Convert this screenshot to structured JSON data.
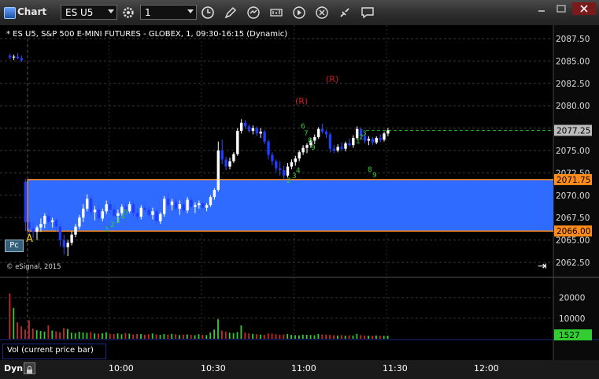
{
  "window": {
    "title": "Chart",
    "symbol": "ES U5",
    "interval": "1"
  },
  "chart": {
    "description": "* ES U5, S&P 500 E-MINI FUTURES - GLOBEX, 1, 09:30-16:15 (Dynamic)",
    "copyright": "© eSignal, 2015",
    "pc_button": "Pc",
    "goto_end_icon": "⇥",
    "price_ticks": [
      "2087.50",
      "2085.00",
      "2082.50",
      "2080.00",
      "2077.25",
      "2075.00",
      "2072.50",
      "2071.75",
      "2070.00",
      "2067.50",
      "2066.00",
      "2065.00",
      "2062.50"
    ],
    "last_price": "2077.25",
    "upper_level": "2071.75",
    "lower_level": "2066.00",
    "annotations": {
      "r1": "(R)",
      "r2": "(R)",
      "a": "A"
    },
    "volume_ticks": [
      "20000",
      "10000"
    ],
    "last_volume": "1527",
    "volume_label": "Vol (current price bar)",
    "time_ticks": [
      "10:00",
      "10:30",
      "11:00",
      "11:30",
      "12:00"
    ],
    "bottom_label": "Dyn",
    "colors": {
      "band": "#2f6bff",
      "level_line": "#ff8c1a",
      "price_box": "#ff8c1a",
      "last_box": "#bcbcbc",
      "vol_up": "#33cc33",
      "vol_down": "#cc2a2a",
      "vol_last_box": "#33cc33"
    }
  },
  "chart_data": {
    "type": "candlestick",
    "bars": [
      [
        2085.6,
        2085.8,
        2085.2,
        2085.4
      ],
      [
        2085.4,
        2085.7,
        2085.1,
        2085.5
      ],
      [
        2085.5,
        2085.9,
        2085.2,
        2085.3
      ],
      [
        2085.3,
        2085.6,
        2084.9,
        2085.1
      ],
      [
        2071.5,
        2071.8,
        2066.0,
        2067.0
      ],
      [
        2067.0,
        2067.5,
        2065.6,
        2066.3
      ],
      [
        2066.3,
        2067.0,
        2065.2,
        2065.9
      ],
      [
        2065.9,
        2066.6,
        2065.0,
        2066.4
      ],
      [
        2066.4,
        2067.4,
        2065.9,
        2066.8
      ],
      [
        2066.8,
        2068.0,
        2066.3,
        2067.7
      ],
      [
        2067.7,
        2068.2,
        2066.8,
        2067.0
      ],
      [
        2067.0,
        2067.5,
        2066.4,
        2067.2
      ],
      [
        2067.2,
        2067.5,
        2066.0,
        2066.5
      ],
      [
        2066.5,
        2066.8,
        2064.3,
        2065.0
      ],
      [
        2065.0,
        2065.6,
        2063.4,
        2064.2
      ],
      [
        2064.2,
        2065.0,
        2063.2,
        2064.7
      ],
      [
        2064.7,
        2066.0,
        2064.4,
        2065.6
      ],
      [
        2065.6,
        2066.8,
        2065.3,
        2066.5
      ],
      [
        2066.5,
        2067.8,
        2066.2,
        2067.5
      ],
      [
        2067.5,
        2069.0,
        2067.0,
        2068.5
      ],
      [
        2068.5,
        2070.1,
        2068.2,
        2069.6
      ],
      [
        2069.6,
        2070.0,
        2067.6,
        2068.1
      ],
      [
        2068.1,
        2068.8,
        2067.2,
        2068.4
      ],
      [
        2068.4,
        2068.9,
        2067.0,
        2067.4
      ],
      [
        2067.4,
        2068.5,
        2067.1,
        2068.2
      ],
      [
        2068.2,
        2069.4,
        2067.9,
        2069.0
      ],
      [
        2069.0,
        2069.5,
        2067.9,
        2068.4
      ],
      [
        2068.4,
        2068.9,
        2067.5,
        2067.7
      ],
      [
        2067.7,
        2068.4,
        2067.0,
        2068.0
      ],
      [
        2068.0,
        2069.0,
        2067.7,
        2068.7
      ],
      [
        2068.7,
        2069.2,
        2067.9,
        2068.2
      ],
      [
        2068.2,
        2069.3,
        2068.0,
        2069.0
      ],
      [
        2069.0,
        2069.4,
        2067.6,
        2068.0
      ],
      [
        2068.0,
        2068.5,
        2067.0,
        2067.6
      ],
      [
        2067.6,
        2068.9,
        2067.3,
        2068.6
      ],
      [
        2068.6,
        2069.3,
        2068.1,
        2068.4
      ],
      [
        2068.4,
        2068.8,
        2067.5,
        2067.8
      ],
      [
        2067.8,
        2068.6,
        2067.3,
        2068.2
      ],
      [
        2068.2,
        2068.5,
        2066.7,
        2067.1
      ],
      [
        2067.1,
        2068.1,
        2066.8,
        2067.9
      ],
      [
        2067.9,
        2069.9,
        2067.6,
        2069.6
      ],
      [
        2069.6,
        2070.4,
        2068.4,
        2068.9
      ],
      [
        2068.9,
        2069.6,
        2068.3,
        2069.3
      ],
      [
        2069.3,
        2069.7,
        2068.2,
        2068.5
      ],
      [
        2068.5,
        2069.4,
        2067.8,
        2069.0
      ],
      [
        2069.0,
        2069.5,
        2068.0,
        2068.3
      ],
      [
        2068.3,
        2069.8,
        2068.0,
        2069.5
      ],
      [
        2069.5,
        2069.9,
        2068.5,
        2068.7
      ],
      [
        2068.7,
        2069.2,
        2068.0,
        2068.9
      ],
      [
        2068.9,
        2069.4,
        2068.5,
        2069.1
      ],
      [
        2069.1,
        2069.5,
        2068.4,
        2068.6
      ],
      [
        2068.6,
        2069.1,
        2068.2,
        2068.9
      ],
      [
        2068.9,
        2070.0,
        2068.7,
        2069.8
      ],
      [
        2069.8,
        2070.8,
        2069.5,
        2070.6
      ],
      [
        2070.6,
        2076.0,
        2070.4,
        2075.0
      ],
      [
        2075.0,
        2076.2,
        2073.5,
        2074.0
      ],
      [
        2074.0,
        2074.3,
        2072.8,
        2073.2
      ],
      [
        2073.2,
        2074.2,
        2072.9,
        2073.8
      ],
      [
        2073.8,
        2074.8,
        2073.6,
        2074.6
      ],
      [
        2074.6,
        2077.5,
        2074.4,
        2077.2
      ],
      [
        2077.2,
        2078.5,
        2076.9,
        2078.1
      ],
      [
        2078.1,
        2078.4,
        2077.4,
        2077.7
      ],
      [
        2077.7,
        2077.9,
        2077.0,
        2077.2
      ],
      [
        2077.2,
        2077.8,
        2076.8,
        2077.5
      ],
      [
        2077.5,
        2077.7,
        2076.6,
        2076.9
      ],
      [
        2076.9,
        2077.5,
        2076.4,
        2077.1
      ],
      [
        2077.1,
        2077.3,
        2075.7,
        2076.0
      ],
      [
        2076.0,
        2076.2,
        2074.0,
        2074.5
      ],
      [
        2074.5,
        2074.8,
        2073.4,
        2073.8
      ],
      [
        2073.8,
        2074.0,
        2072.6,
        2073.0
      ],
      [
        2073.0,
        2073.8,
        2072.2,
        2072.8
      ],
      [
        2072.8,
        2073.3,
        2071.8,
        2072.2
      ],
      [
        2072.2,
        2073.6,
        2072.0,
        2073.2
      ],
      [
        2073.2,
        2074.0,
        2072.9,
        2073.7
      ],
      [
        2073.7,
        2074.4,
        2073.3,
        2074.1
      ],
      [
        2074.1,
        2075.0,
        2073.8,
        2074.8
      ],
      [
        2074.8,
        2075.6,
        2074.5,
        2075.3
      ],
      [
        2075.3,
        2075.8,
        2074.7,
        2075.6
      ],
      [
        2075.6,
        2076.4,
        2075.3,
        2076.1
      ],
      [
        2076.1,
        2076.8,
        2075.7,
        2076.5
      ],
      [
        2076.5,
        2077.6,
        2076.3,
        2077.4
      ],
      [
        2077.4,
        2078.0,
        2076.9,
        2077.1
      ],
      [
        2077.1,
        2077.3,
        2076.4,
        2076.8
      ],
      [
        2076.8,
        2077.0,
        2074.8,
        2075.2
      ],
      [
        2075.2,
        2075.6,
        2074.7,
        2075.0
      ],
      [
        2075.0,
        2075.7,
        2074.8,
        2075.4
      ],
      [
        2075.4,
        2075.9,
        2075.0,
        2075.2
      ],
      [
        2075.2,
        2076.0,
        2074.9,
        2075.8
      ],
      [
        2075.8,
        2076.3,
        2075.4,
        2075.6
      ],
      [
        2075.6,
        2076.7,
        2075.3,
        2076.4
      ],
      [
        2076.4,
        2077.7,
        2076.2,
        2077.4
      ],
      [
        2077.4,
        2077.6,
        2076.3,
        2076.6
      ],
      [
        2076.6,
        2076.9,
        2075.8,
        2076.1
      ],
      [
        2076.1,
        2076.6,
        2075.6,
        2076.3
      ],
      [
        2076.3,
        2076.5,
        2075.6,
        2075.9
      ],
      [
        2075.9,
        2076.6,
        2075.7,
        2076.4
      ],
      [
        2076.4,
        2076.8,
        2075.9,
        2076.2
      ],
      [
        2076.2,
        2077.1,
        2076.0,
        2076.9
      ],
      [
        2076.9,
        2077.5,
        2076.6,
        2077.25
      ]
    ],
    "volume": [
      22000,
      15000,
      8000,
      6000,
      4500,
      9000,
      5000,
      4200,
      3800,
      3500,
      6500,
      4000,
      3600,
      3200,
      5200,
      4800,
      3000,
      2800,
      3400,
      3100,
      2900,
      3300,
      2600,
      2500,
      2700,
      3200,
      2400,
      2300,
      2600,
      2200,
      2800,
      2500,
      2100,
      2400,
      2300,
      2000,
      2200,
      2600,
      2100,
      1900,
      2300,
      2000,
      2400,
      2200,
      1800,
      2000,
      2100,
      1900,
      1700,
      2200,
      2000,
      1800,
      3000,
      4500,
      9500,
      4000,
      3500,
      3000,
      2800,
      3300,
      6500,
      3000,
      2600,
      2400,
      2200,
      2000,
      1900,
      2600,
      2500,
      2200,
      2000,
      2100,
      2300,
      1900,
      1800,
      1700,
      2000,
      1900,
      1800,
      1700,
      2300,
      2100,
      2000,
      1900,
      1700,
      1600,
      1800,
      1500,
      1700,
      1600,
      2400,
      1800,
      1600,
      1500,
      1400,
      1600,
      1500,
      1400,
      1527
    ],
    "ylim": [
      2061,
      2089
    ],
    "vol_ylim": [
      0,
      26000
    ]
  }
}
